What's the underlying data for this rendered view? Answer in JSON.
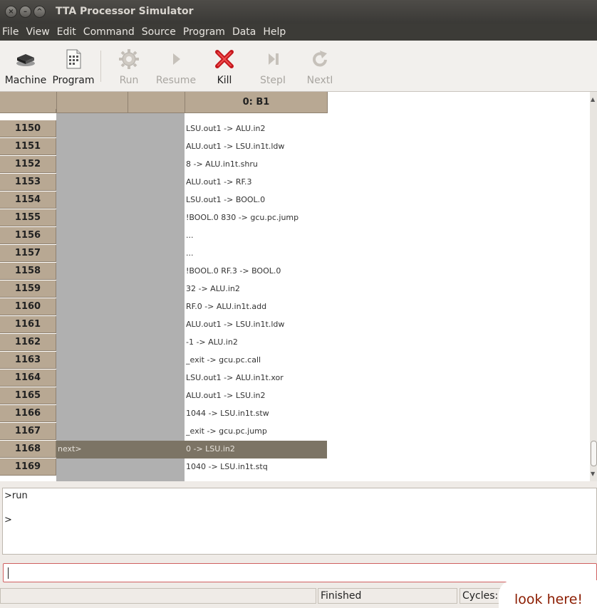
{
  "window": {
    "title": "TTA Processor Simulator"
  },
  "menu": [
    "File",
    "View",
    "Edit",
    "Command",
    "Source",
    "Program",
    "Data",
    "Help"
  ],
  "toolbar": {
    "machine": "Machine",
    "program": "Program",
    "run": "Run",
    "resume": "Resume",
    "kill": "Kill",
    "stepi": "StepI",
    "nexti": "NextI"
  },
  "grid": {
    "bus_header": "0: B1",
    "current_marker": "next>",
    "rows": [
      {
        "n": "1150",
        "ins": "LSU.out1 -> ALU.in2"
      },
      {
        "n": "1151",
        "ins": "ALU.out1 -> LSU.in1t.ldw"
      },
      {
        "n": "1152",
        "ins": "8 -> ALU.in1t.shru"
      },
      {
        "n": "1153",
        "ins": "ALU.out1 -> RF.3"
      },
      {
        "n": "1154",
        "ins": "LSU.out1 -> BOOL.0"
      },
      {
        "n": "1155",
        "ins": "!BOOL.0 830 -> gcu.pc.jump"
      },
      {
        "n": "1156",
        "ins": "..."
      },
      {
        "n": "1157",
        "ins": "..."
      },
      {
        "n": "1158",
        "ins": "!BOOL.0 RF.3 -> BOOL.0"
      },
      {
        "n": "1159",
        "ins": "32 -> ALU.in2"
      },
      {
        "n": "1160",
        "ins": "RF.0 -> ALU.in1t.add"
      },
      {
        "n": "1161",
        "ins": "ALU.out1 -> LSU.in1t.ldw"
      },
      {
        "n": "1162",
        "ins": "-1 -> ALU.in2"
      },
      {
        "n": "1163",
        "ins": "_exit -> gcu.pc.call"
      },
      {
        "n": "1164",
        "ins": "LSU.out1 -> ALU.in1t.xor"
      },
      {
        "n": "1165",
        "ins": "ALU.out1 -> LSU.in2"
      },
      {
        "n": "1166",
        "ins": "1044 -> LSU.in1t.stw"
      },
      {
        "n": "1167",
        "ins": "_exit -> gcu.pc.jump"
      },
      {
        "n": "1168",
        "ins": "0 -> LSU.in2"
      },
      {
        "n": "1169",
        "ins": "1040 -> LSU.in1t.stq"
      }
    ]
  },
  "console": {
    "lines": [
      ">run",
      "",
      ">"
    ]
  },
  "status": {
    "state": "Finished",
    "cycles_label": "Cycles:",
    "overlay": "look here!"
  }
}
